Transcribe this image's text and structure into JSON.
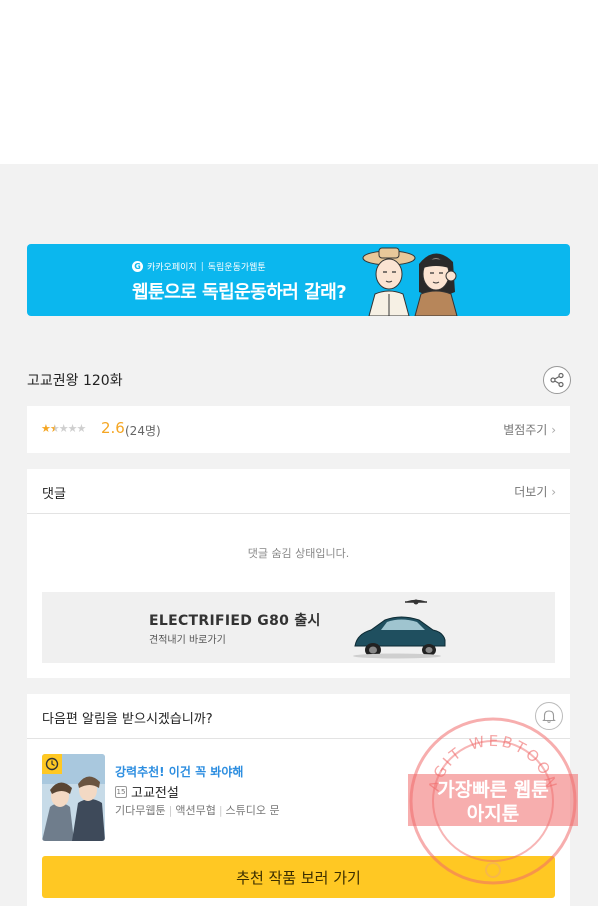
{
  "banner": {
    "brand": "카카오페이지",
    "sub_tag": "독립운동가웹툰",
    "headline": "웹툰으로 독립운동하러 갈래?"
  },
  "episode": {
    "title": "고교권왕 120화"
  },
  "rating": {
    "stars_filled": 1.5,
    "stars_total": 5,
    "score": "2.6",
    "count": "(24명)",
    "rate_label": "별점주기"
  },
  "comments": {
    "title": "댓글",
    "more_label": "더보기",
    "hidden_message": "댓글 숨김 상태입니다."
  },
  "ad": {
    "headline": "ELECTRIFIED G80 출시",
    "subline": "견적내기 바로가기"
  },
  "notify": {
    "question": "다음편 알림을 받으시겠습니까?"
  },
  "recommend": {
    "tag": "강력추천! 이건 꼭 봐야해",
    "age": "15",
    "title": "고교전설",
    "genre1": "기다무웹툰",
    "genre2": "액션무협",
    "studio": "스튜디오 문",
    "cta_label": "추천 작품 보러 가기"
  },
  "watermark": {
    "arc_text": "AGIT WEBTOON",
    "line1": "가장빠른 웹툰",
    "line2": "아지툰"
  },
  "colors": {
    "banner_bg": "#0bb7ee",
    "star": "#f5a623",
    "cta": "#ffc823",
    "link_blue": "#2d8ee0"
  }
}
